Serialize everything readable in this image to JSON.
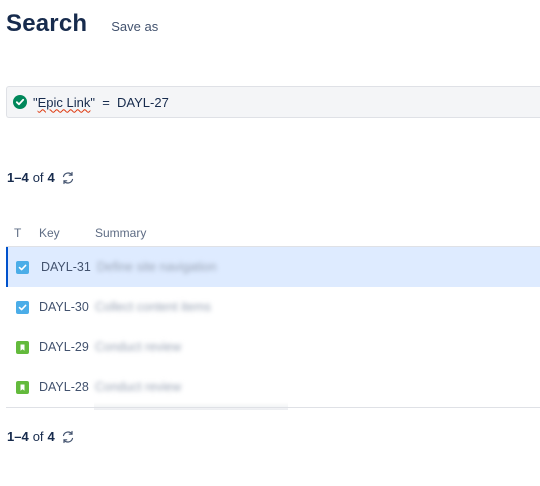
{
  "header": {
    "title": "Search",
    "save_as": "Save as"
  },
  "jql": {
    "open_quote": "\"",
    "field": "Epic Link",
    "rest": "\"  =  DAYL-27",
    "status_icon": "check-circle-icon",
    "status_color": "#00875a"
  },
  "pager_top": {
    "range": "1–4",
    "of": "of",
    "total": "4"
  },
  "pager_bottom": {
    "range": "1–4",
    "of": "of",
    "total": "4"
  },
  "table": {
    "columns": {
      "type": "T",
      "key": "Key",
      "summary": "Summary"
    },
    "rows": [
      {
        "key": "DAYL-31",
        "summary": "Define site navigation",
        "type": "task",
        "selected": true
      },
      {
        "key": "DAYL-30",
        "summary": "Collect content items",
        "type": "task",
        "selected": false
      },
      {
        "key": "DAYL-29",
        "summary": "Conduct review",
        "type": "story",
        "selected": false
      },
      {
        "key": "DAYL-28",
        "summary": "Conduct review",
        "type": "story",
        "selected": false
      }
    ]
  },
  "colors": {
    "text": "#172b4d",
    "task": "#4bade8",
    "story": "#63ba3c",
    "selected_bg": "#deebff",
    "selected_border": "#0052cc"
  }
}
